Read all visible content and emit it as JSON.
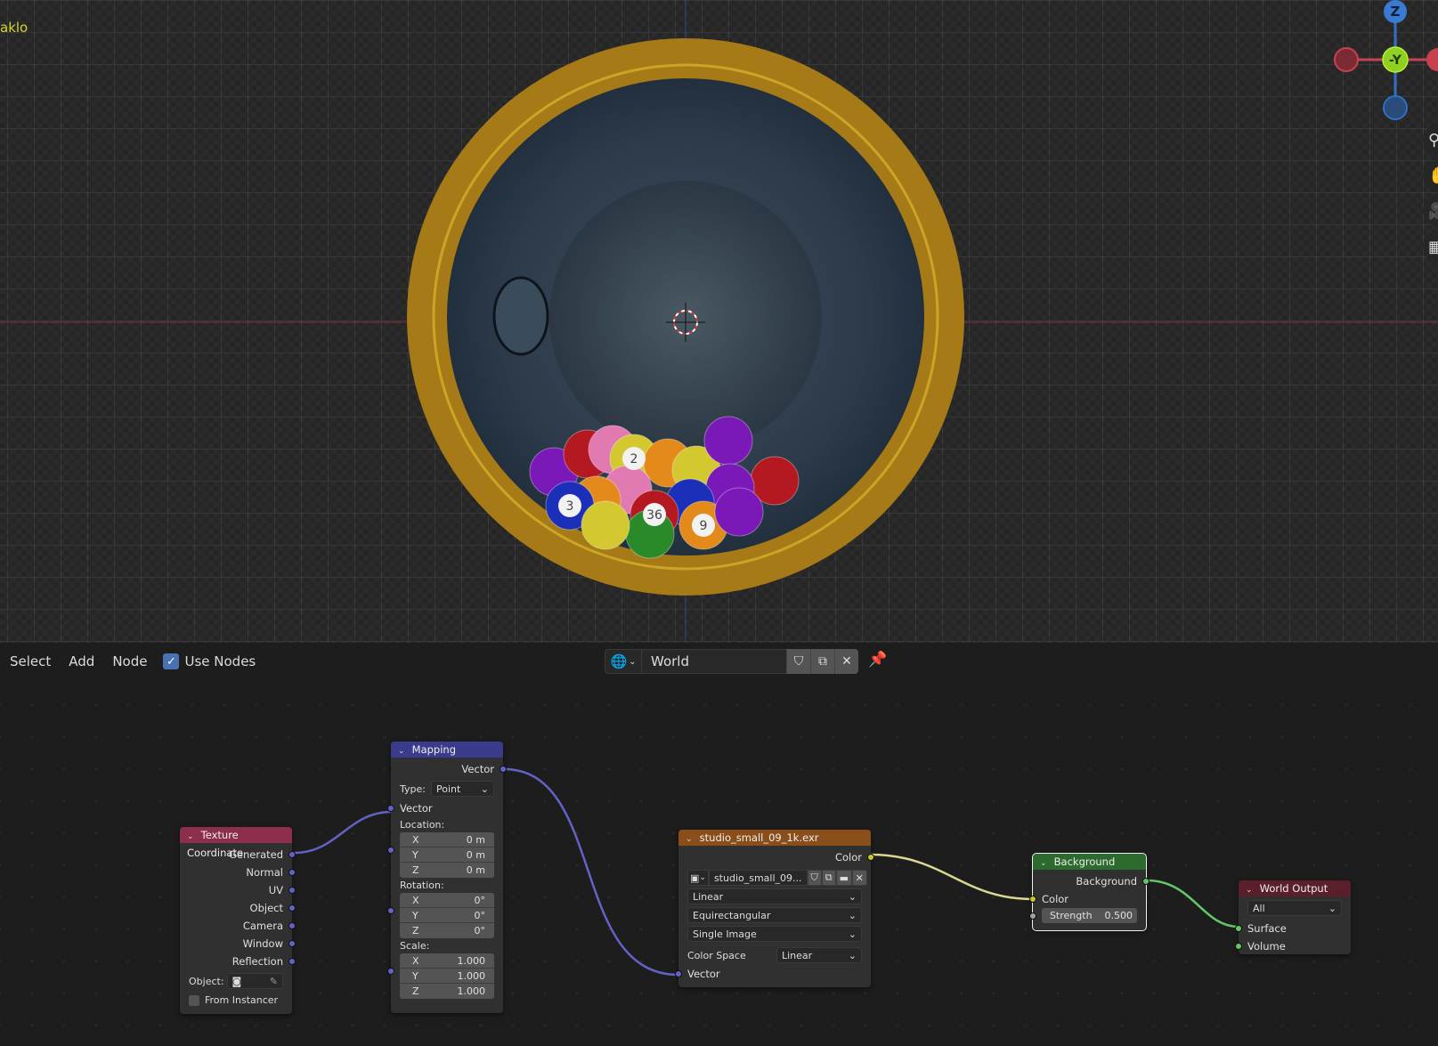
{
  "viewport": {
    "active_object_label": "aklo",
    "gizmo": {
      "z_label": "Z",
      "y_label": "-Y"
    },
    "nav_icons": [
      "zoom-icon",
      "pan-hand-icon",
      "camera-icon",
      "grid-icon"
    ],
    "nav_glyphs": [
      "⚲",
      "✋",
      "🎥",
      "▦"
    ],
    "ball_labels": [
      "2",
      "36",
      "3",
      "9"
    ],
    "colors": {
      "ring": "#b88a1a",
      "bowl": "#2d3b4b",
      "x_axis": "#c8414f",
      "y_gizmo": "#8fd023",
      "z_axis": "#2f6fc4"
    }
  },
  "header": {
    "menus": [
      "Select",
      "Add",
      "Node"
    ],
    "use_nodes_label": "Use Nodes",
    "use_nodes_checked": true,
    "world_type_glyph": "🌐",
    "world_name": "World",
    "fake_user_glyph": "⛉",
    "duplicate_glyph": "⧉",
    "unlink_glyph": "✕",
    "pin_glyph": "📌"
  },
  "nodes": {
    "texture_coordinate": {
      "title": "Texture Coordinate",
      "outputs": [
        "Generated",
        "Normal",
        "UV",
        "Object",
        "Camera",
        "Window",
        "Reflection"
      ],
      "object_label": "Object:",
      "object_value": "",
      "from_instancer_label": "From Instancer",
      "from_instancer_checked": false,
      "header_color": "#8c2e4c"
    },
    "mapping": {
      "title": "Mapping",
      "output": "Vector",
      "type_label": "Type:",
      "type_value": "Point",
      "input_vector": "Vector",
      "location_label": "Location:",
      "location": [
        {
          "axis": "X",
          "value": "0 m"
        },
        {
          "axis": "Y",
          "value": "0 m"
        },
        {
          "axis": "Z",
          "value": "0 m"
        }
      ],
      "rotation_label": "Rotation:",
      "rotation": [
        {
          "axis": "X",
          "value": "0°"
        },
        {
          "axis": "Y",
          "value": "0°"
        },
        {
          "axis": "Z",
          "value": "0°"
        }
      ],
      "scale_label": "Scale:",
      "scale": [
        {
          "axis": "X",
          "value": "1.000"
        },
        {
          "axis": "Y",
          "value": "1.000"
        },
        {
          "axis": "Z",
          "value": "1.000"
        }
      ],
      "header_color": "#3b3b8e"
    },
    "environment_texture": {
      "title": "studio_small_09_1k.exr",
      "output": "Color",
      "image_name": "studio_small_09...",
      "interpolation": "Linear",
      "projection": "Equirectangular",
      "source": "Single Image",
      "color_space_label": "Color Space",
      "color_space": "Linear",
      "input_vector": "Vector",
      "header_color": "#8a4e1a"
    },
    "background": {
      "title": "Background",
      "output": "Background",
      "input_color": "Color",
      "strength_label": "Strength",
      "strength_value": "0.500",
      "header_color": "#2d6a2d"
    },
    "world_output": {
      "title": "World Output",
      "target": "All",
      "inputs": [
        "Surface",
        "Volume"
      ],
      "header_color": "#5a1f2a"
    }
  }
}
